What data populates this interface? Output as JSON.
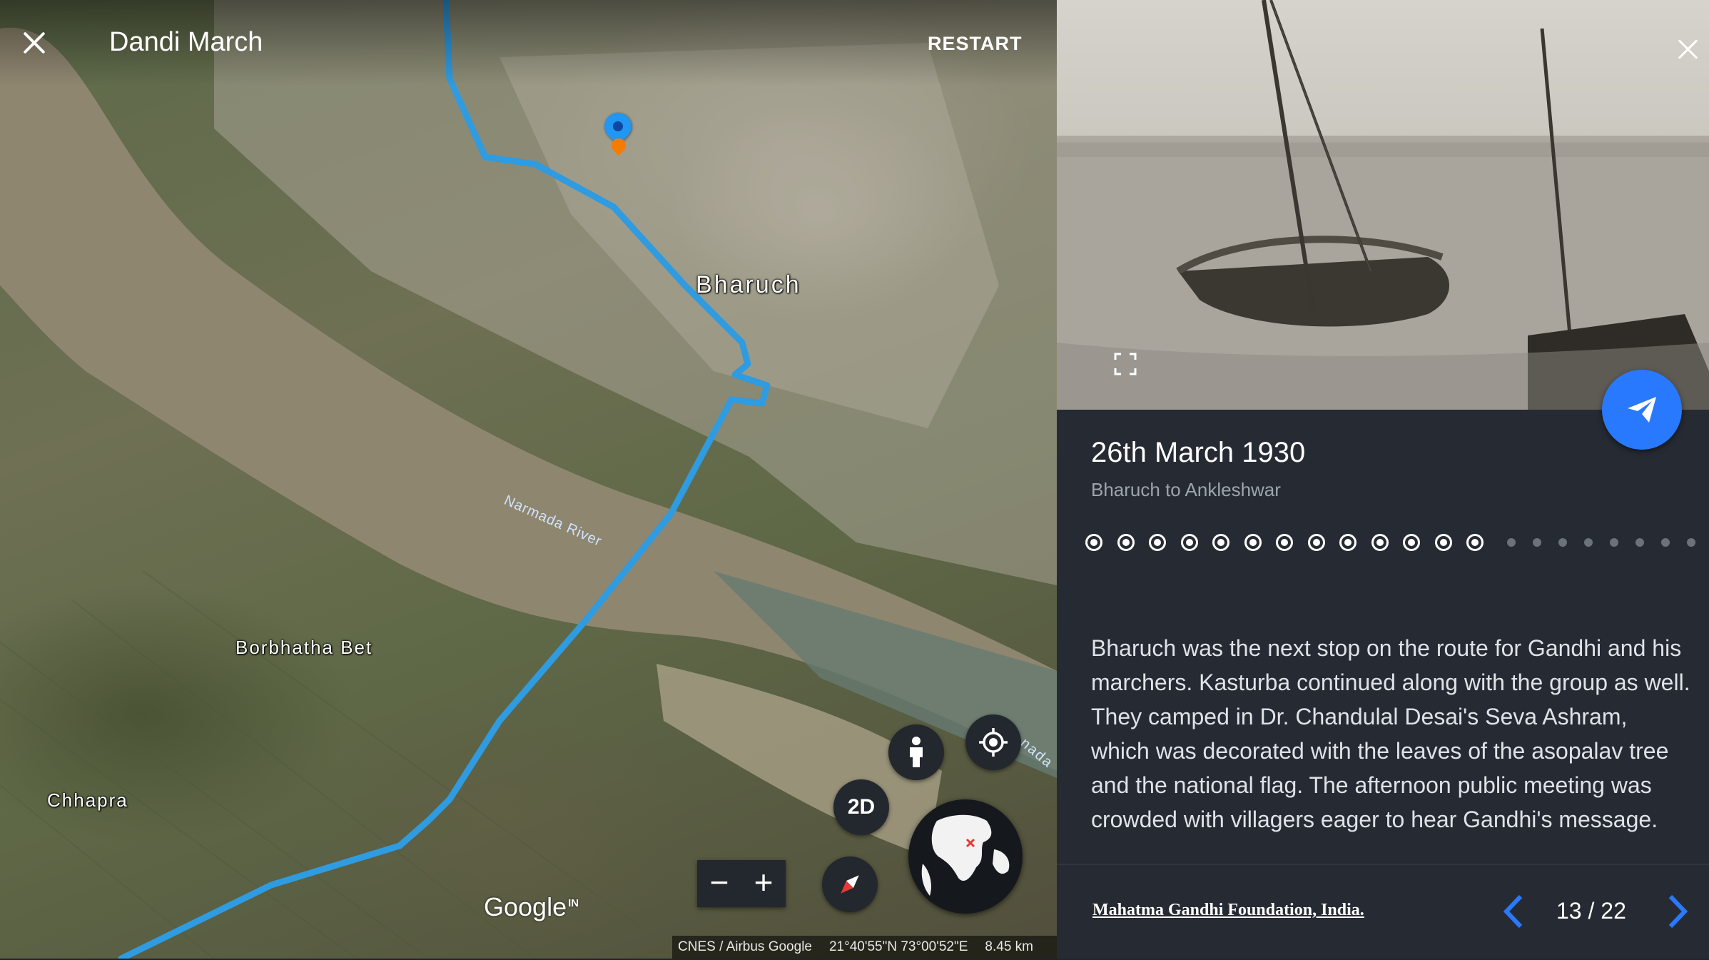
{
  "map": {
    "title": "Dandi March",
    "restart_label": "RESTART",
    "labels": {
      "city": "Bharuch",
      "river": "Narmada River",
      "river_clip": "nada I",
      "village_1": "Borbhatha Bet",
      "village_2": "Chhapra"
    },
    "controls": {
      "mode_2d": "2D",
      "zoom_out": "−",
      "zoom_in": "+"
    },
    "logo": "Google",
    "logo_region": "IN",
    "attribution": "CNES / Airbus  Google",
    "coordinates": "21°40'55\"N 73°00'52\"E",
    "scale": "8.45 km",
    "route_color": "#2f9be0"
  },
  "panel": {
    "date": "26th March 1930",
    "subtitle": "Bharuch to Ankleshwar",
    "progress": {
      "current": 13,
      "total": 22
    },
    "body": "Bharuch was the next stop on the route for Gandhi and his marchers. Kasturba continued along with the group as well. They camped in Dr. Chandulal Desai's Seva Ashram, which was decorated with the leaves of the asopalav tree and the national flag. The afternoon public meeting was crowded with villagers eager to hear Gandhi's message.",
    "source": "Mahatma Gandhi Foundation, India.",
    "counter": "13 / 22",
    "accent": "#2979ff",
    "background": "#262b33"
  }
}
